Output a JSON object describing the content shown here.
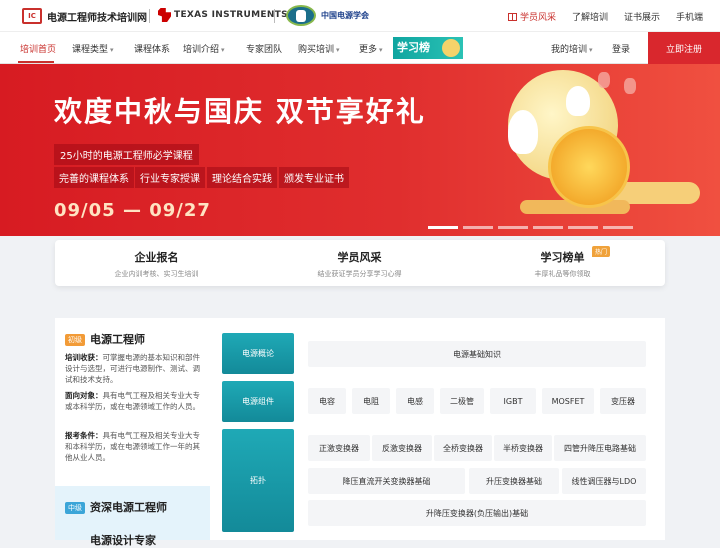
{
  "topbar": {
    "logo_text": "IC",
    "site_name": "电源工程师技术培训网",
    "ti_text": "TEXAS INSTRUMENTS",
    "cps_text": "中国电源学会",
    "links": [
      "学员风采",
      "了解培训",
      "证书展示",
      "手机端"
    ]
  },
  "nav": {
    "items": [
      "培训首页",
      "课程类型",
      "课程体系",
      "培训介绍",
      "专家团队",
      "购买培训",
      "更多"
    ],
    "study_badge": "学习榜",
    "my_training": "我的培训",
    "login": "登录",
    "register": "立即注册"
  },
  "banner": {
    "title": "欢度中秋与国庆 双节享好礼",
    "subtitle": "25小时的电源工程师必学课程",
    "tags": [
      "完善的课程体系",
      "行业专家授课",
      "理论结合实践",
      "颁发专业证书"
    ],
    "date": "09/05 — 09/27"
  },
  "quick_links": [
    {
      "title": "企业报名",
      "desc": "企业内训考核、实习生培训"
    },
    {
      "title": "学员风采",
      "desc": "结业获证学员分享学习心得"
    },
    {
      "title": "学习榜单",
      "desc": "丰厚礼品等你领取",
      "badge": "热门"
    }
  ],
  "levels": {
    "junior": {
      "tag": "初级",
      "title": "电源工程师",
      "goal_label": "培训收获：",
      "goal": "可掌握电源的基本知识和部件设计与选型，可进行电源制作、测试、调试和技术支持。",
      "audience_label": "面向对象：",
      "audience": "具有电气工程及相关专业大专或本科学历，或在电源领域工作的人员。",
      "req_label": "报考条件：",
      "req": "具有电气工程及相关专业大专和本科学历，或在电源领域工作一年的其他从业人员。"
    },
    "mid": {
      "tag": "中级",
      "title": "资深电源工程师",
      "next_title": "电源设计专家"
    }
  },
  "categories": [
    {
      "name": "电源概论",
      "chips": [
        "电源基础知识"
      ]
    },
    {
      "name": "电源组件",
      "chips": [
        "电容",
        "电阻",
        "电感",
        "二极管",
        "IGBT",
        "MOSFET",
        "变压器"
      ]
    },
    {
      "name": "拓扑",
      "chips": [
        "正激变换器",
        "反激变换器",
        "全桥变换器",
        "半桥变换器",
        "四管升降压电路基础",
        "降压直流开关变换器基础",
        "升压变换器基础",
        "线性调压器与LDO",
        "升降压变换器(负压输出)基础"
      ]
    }
  ]
}
